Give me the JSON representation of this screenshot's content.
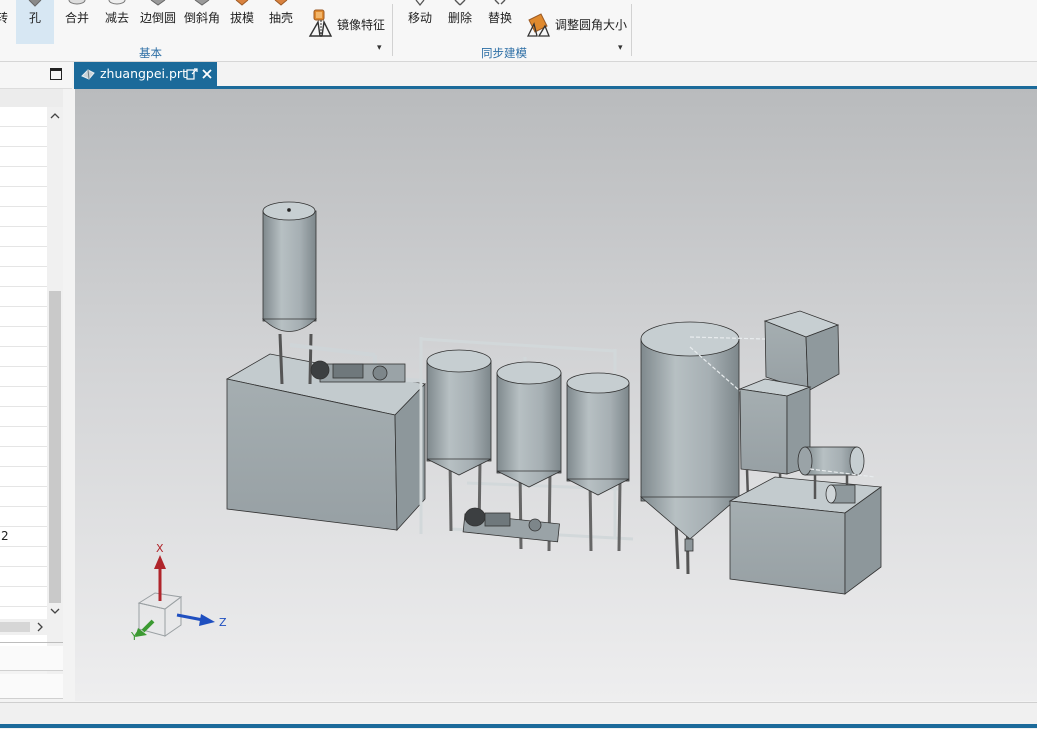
{
  "ribbon": {
    "basic_group": {
      "label": "基本",
      "tools": [
        {
          "label": "转",
          "name": "rotate"
        },
        {
          "label": "孔",
          "name": "hole"
        },
        {
          "label": "合并",
          "name": "unite"
        },
        {
          "label": "减去",
          "name": "subtract"
        },
        {
          "label": "边倒圆",
          "name": "edge-blend"
        },
        {
          "label": "倒斜角",
          "name": "chamfer"
        },
        {
          "label": "拔模",
          "name": "draft"
        },
        {
          "label": "抽壳",
          "name": "shell"
        }
      ],
      "mirror_feature": "镜像特征"
    },
    "sync_group": {
      "label": "同步建模",
      "tools": [
        {
          "label": "移动",
          "name": "move"
        },
        {
          "label": "删除",
          "name": "delete"
        },
        {
          "label": "替换",
          "name": "replace"
        }
      ],
      "resize_blend": "调整圆角大小"
    }
  },
  "navigator": {
    "row_value": "2"
  },
  "tab": {
    "filename": "zhuangpei.prt"
  },
  "triad": {
    "x": "X",
    "y": "Y",
    "z": "Z"
  },
  "colors": {
    "accent": "#1b6a9a",
    "group_label": "#2c6ea5",
    "equipment": "#a9b3b7"
  }
}
